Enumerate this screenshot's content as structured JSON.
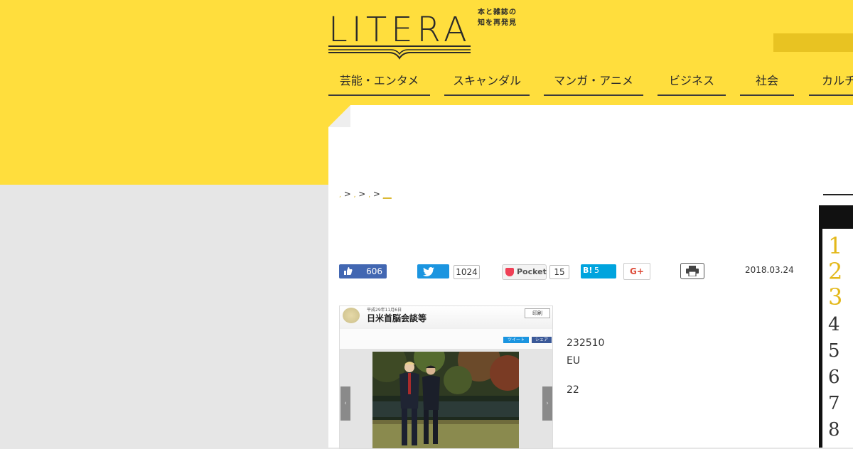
{
  "site": {
    "logo_text": "LITERA",
    "tagline_line1": "本と雑誌の",
    "tagline_line2": "知を再発見"
  },
  "nav": {
    "items": [
      {
        "label": "芸能・エンタメ"
      },
      {
        "label": "スキャンダル"
      },
      {
        "label": "マンガ・アニメ"
      },
      {
        "label": "ビジネス"
      },
      {
        "label": "社会"
      },
      {
        "label": "カルチ"
      }
    ]
  },
  "breadcrumb": {
    "sep1": ">",
    "sep2": ">",
    "sep3": ">",
    "current": "__"
  },
  "share": {
    "facebook_count": "606",
    "twitter_count": "1024",
    "pocket_label": "Pocket",
    "pocket_count": "15",
    "hatena_label": "B!",
    "hatena_count": "5",
    "gplus_label": "G+"
  },
  "article": {
    "date": "2018.03.24",
    "image": {
      "date_text": "平成29年11月6日",
      "title": "日米首脳会談等",
      "print_button": "印刷",
      "tweet_button": "ツイート",
      "share_button": "シェア",
      "prev_arrow": "‹",
      "next_arrow": "›"
    },
    "lines": [
      "232510",
      "EU",
      "22"
    ]
  },
  "ranking": {
    "numbers": [
      "1",
      "2",
      "3",
      "4",
      "5",
      "6",
      "7",
      "8"
    ],
    "accent_color": "#e3b81a"
  },
  "colors": {
    "brand_yellow": "#ffde3d",
    "facebook": "#4267b2",
    "twitter": "#1b95e0",
    "hatena": "#00a4de",
    "pocket": "#ef4056"
  }
}
